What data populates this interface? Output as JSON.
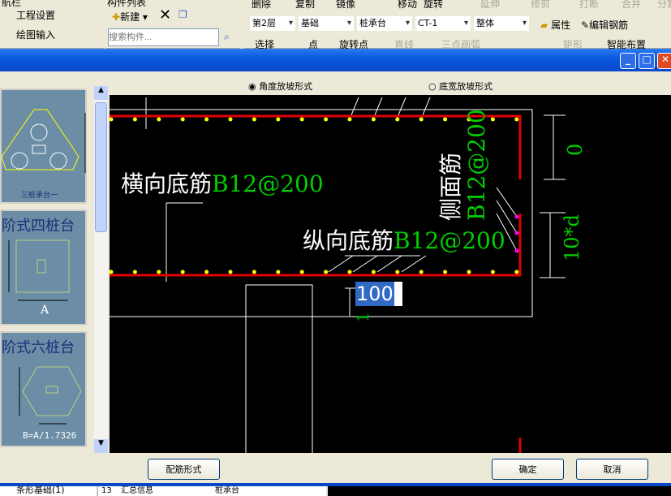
{
  "nav_panel": {
    "title": "航栏",
    "items": [
      "工程设置",
      "绘图输入"
    ]
  },
  "component_list": {
    "title": "构件列表",
    "new_label": "新建",
    "search_placeholder": "搜索构件..."
  },
  "toolbar_row1": [
    "删除",
    "复制",
    "镜像",
    "移动",
    "旋转",
    "延伸",
    "修剪",
    "打断",
    "合并",
    "分割"
  ],
  "toolbar_row2": {
    "floor": "第2层",
    "category": "基础",
    "type": "桩承台",
    "name": "CT-1",
    "mode": "整体",
    "property": "属性",
    "edit_rebar": "编辑钢筋"
  },
  "toolbar_row3": [
    "选择",
    "点",
    "旋转点",
    "直线",
    "三点画弧",
    "矩形",
    "智能布置"
  ],
  "dialog": {
    "radio_options": [
      {
        "label": "角度放坡形式",
        "checked": true
      },
      {
        "label": "底宽放坡形式",
        "checked": false
      }
    ],
    "thumbnails": [
      {
        "title": "",
        "caption": "三桩承台一"
      },
      {
        "title": "阶式四桩台",
        "caption": "A"
      },
      {
        "title": "阶式六桩台",
        "caption": "B=A/1.7326"
      }
    ],
    "drawing": {
      "transverse_label": "横向底筋",
      "transverse_value": "B12@200",
      "longitudinal_label": "纵向底筋",
      "longitudinal_value": "B12@200",
      "side_label": "侧面筋",
      "side_value": "B12@200",
      "dim_top": "0",
      "dim_bottom": "10*d",
      "dim_small": "1",
      "input_value": "100"
    },
    "buttons": {
      "rebar_form": "配筋形式",
      "ok": "确定",
      "cancel": "取消"
    }
  },
  "background_bottom": {
    "tree_item": "条形基础(1)",
    "row_num": "13",
    "cell1": "汇总信息",
    "cell2": "桩承台"
  },
  "colors": {
    "titlebar": "#0a5ae0",
    "canvas": "#000000",
    "rebar": "#e00000",
    "dot": "#ffff00",
    "green_text": "#00d000"
  }
}
